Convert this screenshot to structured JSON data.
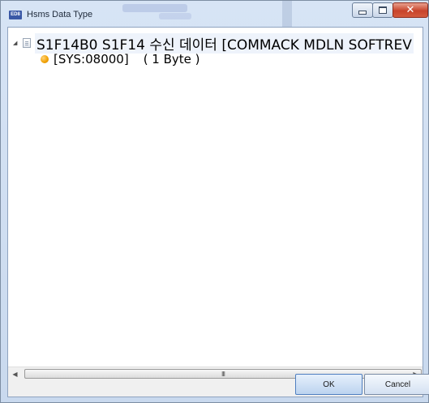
{
  "window": {
    "app_icon_text": "ED8",
    "title": "Hsms Data Type",
    "buttons": {
      "minimize": "minimize",
      "maximize": "maximize",
      "close": "✕"
    }
  },
  "tree": {
    "root": {
      "expander": "◢",
      "label": "S1F14B0 S1F14 수신 데이터 [COMMACK MDLN SOFTREV"
    },
    "children": [
      {
        "label": "[SYS:08000]",
        "type": "( 1 Byte )"
      }
    ]
  },
  "scrollbar": {
    "left": "◀",
    "right": "▶",
    "grip": "III"
  },
  "footer": {
    "ok_label": "OK",
    "cancel_label": "Cancel"
  },
  "colors": {
    "accent": "#3a58a6",
    "node_dot": "#f0a000",
    "close_button": "#c8442b"
  }
}
